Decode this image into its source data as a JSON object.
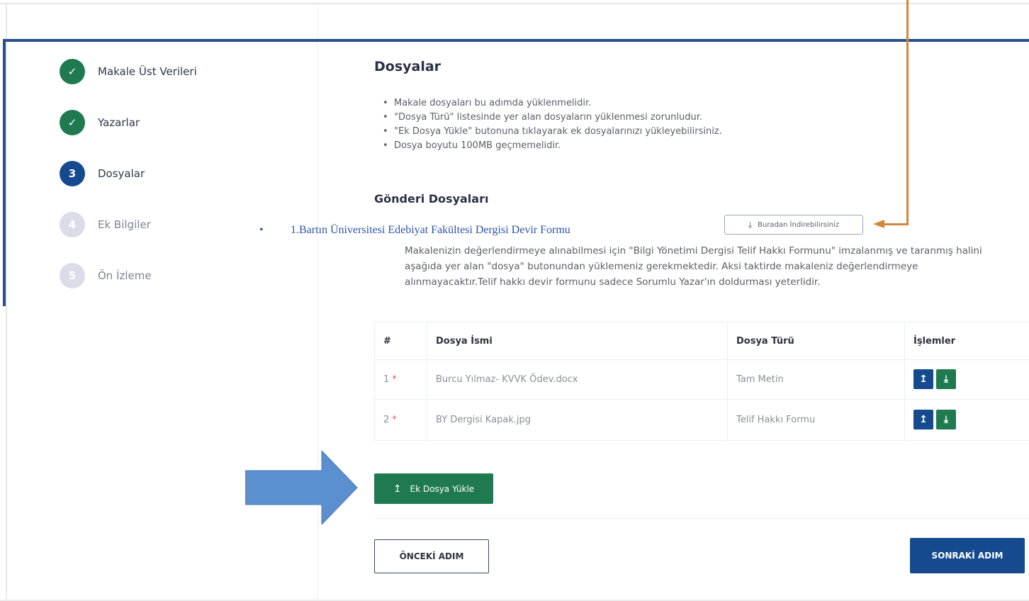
{
  "steps": [
    {
      "marker": "✓",
      "label": "Makale Üst Verileri",
      "state": "done"
    },
    {
      "marker": "✓",
      "label": "Yazarlar",
      "state": "done"
    },
    {
      "marker": "3",
      "label": "Dosyalar",
      "state": "active"
    },
    {
      "marker": "4",
      "label": "Ek Bilgiler",
      "state": "pending"
    },
    {
      "marker": "5",
      "label": "Ön İzleme",
      "state": "pending"
    }
  ],
  "main": {
    "title": "Dosyalar",
    "bullets": [
      "Makale dosyaları bu adımda yüklenmelidir.",
      "\"Dosya Türü\" listesinde yer alan dosyaların yüklenmesi zorunludur.",
      "\"Ek Dosya Yükle\" butonuna tıklayarak ek dosyalarınızı yükleyebilirsiniz.",
      "Dosya boyutu 100MB geçmemelidir."
    ],
    "section_title": "Gönderi Dosyaları",
    "overlay_bullet": "•",
    "overlay_text": "1.Bartın Üniversitesi Edebiyat Fakültesi Dergisi Devir Formu",
    "download_link_label": "Buradan İndirebilirsiniz",
    "paragraph": "Makalenizin değerlendirmeye alınabilmesi için \"Bilgi Yönetimi Dergisi Telif Hakkı Formunu\" imzalanmış ve taranmış halini aşağıda yer alan \"dosya\" butonundan yüklemeniz gerekmektedir. Aksi taktirde makaleniz değerlendirmeye alınmayacaktır.Telif hakkı devir formunu sadece Sorumlu Yazar'ın doldurması yeterlidir."
  },
  "table": {
    "headers": [
      "#",
      "Dosya İsmi",
      "Dosya Türü",
      "İşlemler"
    ],
    "rows": [
      {
        "no": "1",
        "required": "*",
        "name": "Burcu Yılmaz- KVVK Ödev.docx",
        "type": "Tam Metin"
      },
      {
        "no": "2",
        "required": "*",
        "name": "BY Dergisi Kapak.jpg",
        "type": "Telif Hakkı Formu"
      }
    ]
  },
  "buttons": {
    "extra_upload": "Ek Dosya Yükle",
    "previous": "ÖNCEKİ ADIM",
    "next": "SONRAKİ ADIM"
  },
  "icons": {
    "check": "check-icon",
    "upload": "upload-icon",
    "download": "download-icon"
  },
  "colors": {
    "success": "#1f7a50",
    "primary": "#154a8f",
    "pending": "#dcdbe8",
    "annotation_blue": "#2a4d8f",
    "annotation_orange": "#d4873a",
    "arrow_fill": "#5b8fd0"
  }
}
